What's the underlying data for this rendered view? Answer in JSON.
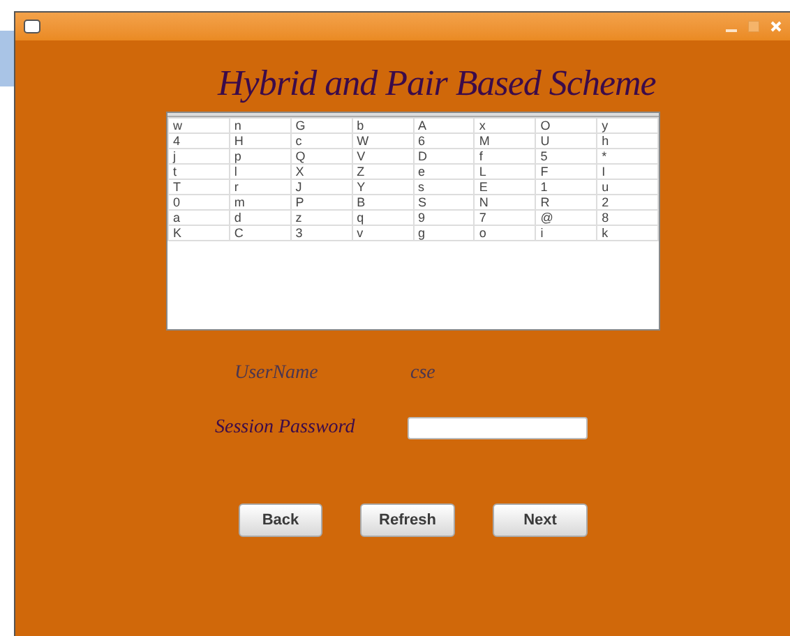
{
  "title": "Hybrid and Pair Based Scheme",
  "grid": {
    "rows": [
      [
        "w",
        "n",
        "G",
        "b",
        "A",
        "x",
        "O",
        "y"
      ],
      [
        "4",
        "H",
        "c",
        "W",
        "6",
        "M",
        "U",
        "h"
      ],
      [
        "j",
        "p",
        "Q",
        "V",
        "D",
        "f",
        "5",
        "*"
      ],
      [
        "t",
        "l",
        "X",
        "Z",
        "e",
        "L",
        "F",
        "I"
      ],
      [
        "T",
        "r",
        "J",
        "Y",
        "s",
        "E",
        "1",
        "u"
      ],
      [
        "0",
        "m",
        "P",
        "B",
        "S",
        "N",
        "R",
        "2"
      ],
      [
        "a",
        "d",
        "z",
        "q",
        "9",
        "7",
        "@",
        "8"
      ],
      [
        "K",
        "C",
        "3",
        "v",
        "g",
        "o",
        "i",
        "k"
      ]
    ]
  },
  "username": {
    "label": "UserName",
    "value": "cse"
  },
  "session_password": {
    "label": "Session Password"
  },
  "buttons": [
    "Back",
    "Refresh",
    "Next"
  ]
}
